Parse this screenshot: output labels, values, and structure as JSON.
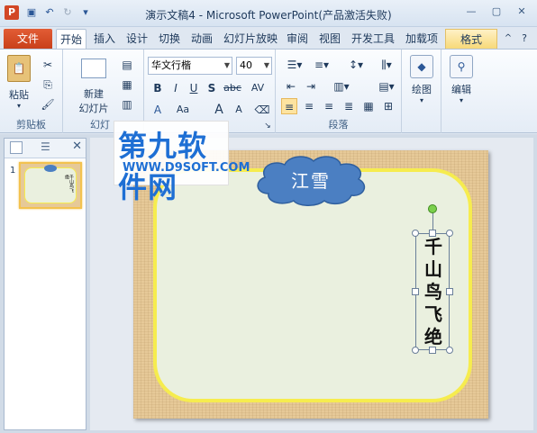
{
  "window": {
    "title": "演示文稿4 - Microsoft PowerPoint(产品激活失败)",
    "app_icon": "P",
    "qat_icons": [
      "save-icon",
      "undo-icon",
      "redo-icon",
      "customize-icon"
    ],
    "controls": [
      "minimize-icon",
      "maximize-icon",
      "close-icon"
    ]
  },
  "tabs": [
    "文件",
    "开始",
    "插入",
    "设计",
    "切换",
    "动画",
    "幻灯片放映",
    "审阅",
    "视图",
    "开发工具",
    "加载项",
    "格式"
  ],
  "active_tab": "开始",
  "contextual_tab": "格式",
  "ribbon": {
    "clipboard": {
      "paste": "粘贴",
      "label": "剪贴板"
    },
    "slides": {
      "new_slide_1": "新建",
      "new_slide_2": "幻灯片",
      "label": "幻灯"
    },
    "font": {
      "name": "华文行楷",
      "size": "40",
      "b": "B",
      "i": "I",
      "u": "U",
      "s": "S",
      "abc": "abc",
      "av": "AV",
      "aa": "Aa",
      "grow": "A",
      "shrink": "A",
      "label": ""
    },
    "paragraph": {
      "label": "段落"
    },
    "drawing": {
      "label": "绘图"
    },
    "editing": {
      "label": "编辑"
    }
  },
  "thumbnail": {
    "slide_number": "1",
    "vertical_text": "千山鸟飞绝"
  },
  "slide": {
    "cloud_text": "江雪",
    "vertical_text": "千山鸟飞绝",
    "vertical_chars": [
      "千",
      "山",
      "鸟",
      "飞",
      "绝"
    ]
  },
  "watermark": {
    "logo": "第九软件网",
    "url": "WWW.D9SOFT.COM"
  },
  "colors": {
    "file_tab": "#d24726",
    "cloud": "#4b7fc2",
    "frame": "#f6ec4e",
    "slide_bg": "#e6c998",
    "watermark": "#1e6fd4"
  }
}
